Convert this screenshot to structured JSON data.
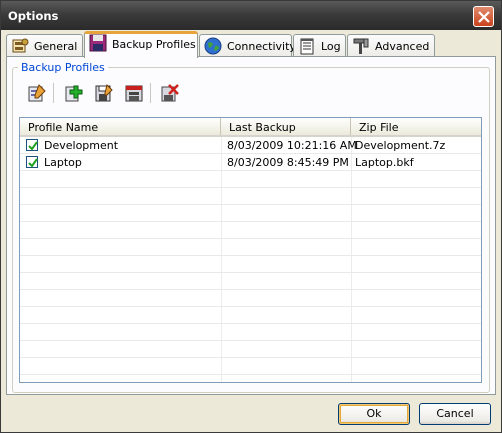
{
  "window": {
    "title": "Options"
  },
  "tabs": [
    {
      "label": "General",
      "icon": "general-settings-icon"
    },
    {
      "label": "Backup Profiles",
      "icon": "floppy-disk-icon",
      "active": true
    },
    {
      "label": "Connectivity",
      "icon": "globe-icon"
    },
    {
      "label": "Log",
      "icon": "notepad-icon"
    },
    {
      "label": "Advanced",
      "icon": "tools-icon"
    }
  ],
  "group": {
    "label": "Backup Profiles"
  },
  "toolbar": {
    "buttons": [
      {
        "name": "edit-profile",
        "icon": "pencil-edit-icon"
      },
      {
        "name": "add-profile",
        "icon": "add-plus-icon"
      },
      {
        "name": "modify-profile",
        "icon": "save-edit-icon"
      },
      {
        "name": "backup-profile",
        "icon": "save-red-icon"
      },
      {
        "name": "delete-profile",
        "icon": "delete-x-icon"
      }
    ]
  },
  "list": {
    "columns": [
      "Profile Name",
      "Last Backup",
      "Zip File"
    ],
    "rows": [
      {
        "checked": true,
        "name": "Development",
        "last_backup": "8/03/2009 10:21:16 AM",
        "zip": "Development.7z"
      },
      {
        "checked": true,
        "name": "Laptop",
        "last_backup": "8/03/2009 8:45:49 PM",
        "zip": "Laptop.bkf"
      }
    ]
  },
  "buttons": {
    "ok": "Ok",
    "cancel": "Cancel"
  },
  "colors": {
    "titlebar": "#3b3b3b",
    "active_tab_accent": "#e6a43a",
    "group_label": "#0046d5",
    "dialog_bg": "#ece9d8"
  }
}
